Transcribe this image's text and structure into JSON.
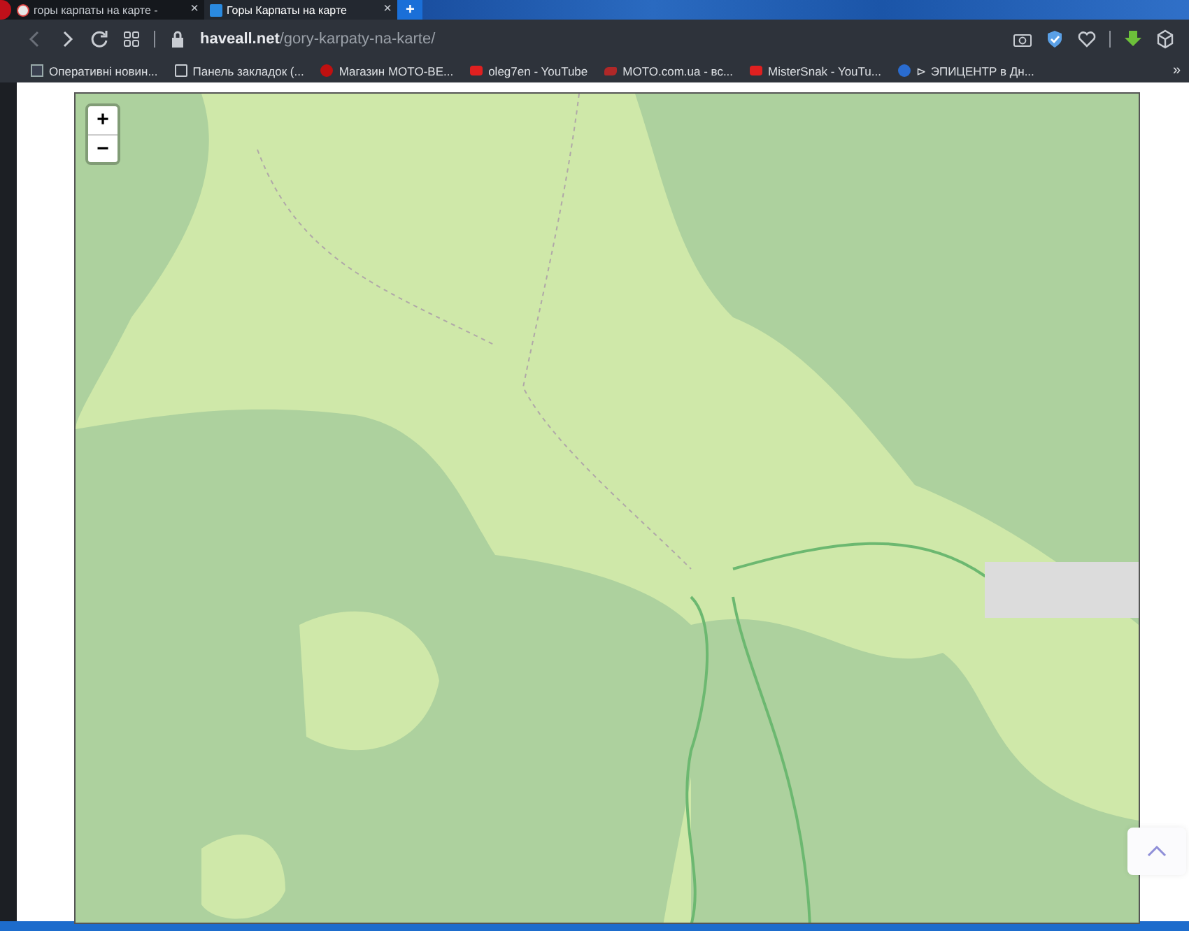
{
  "tabs": [
    {
      "title": "горы карпаты на карте - ",
      "selected": false,
      "close": "×"
    },
    {
      "title": "Горы Карпаты на карте",
      "selected": true,
      "close": "×"
    }
  ],
  "new_tab": "+",
  "address_bar": {
    "domain": "haveall.net",
    "path": "/gory-karpaty-na-karte/"
  },
  "bookmarks": [
    {
      "label": "Оперативні новин...",
      "kind": "news"
    },
    {
      "label": "Панель закладок (...",
      "kind": "folder"
    },
    {
      "label": "Магазин MOTO-BE...",
      "kind": "moto"
    },
    {
      "label": "oleg7en - YouTube",
      "kind": "youtube"
    },
    {
      "label": "MOTO.com.ua - вс...",
      "kind": "bike"
    },
    {
      "label": "MisterSnak - YouTu...",
      "kind": "youtube"
    },
    {
      "label": "⊳ ЭПИЦЕНТР в Дн...",
      "kind": "shield"
    }
  ],
  "bookmarks_more": "»",
  "map": {
    "zoom_in": "+",
    "zoom_out": "−"
  }
}
